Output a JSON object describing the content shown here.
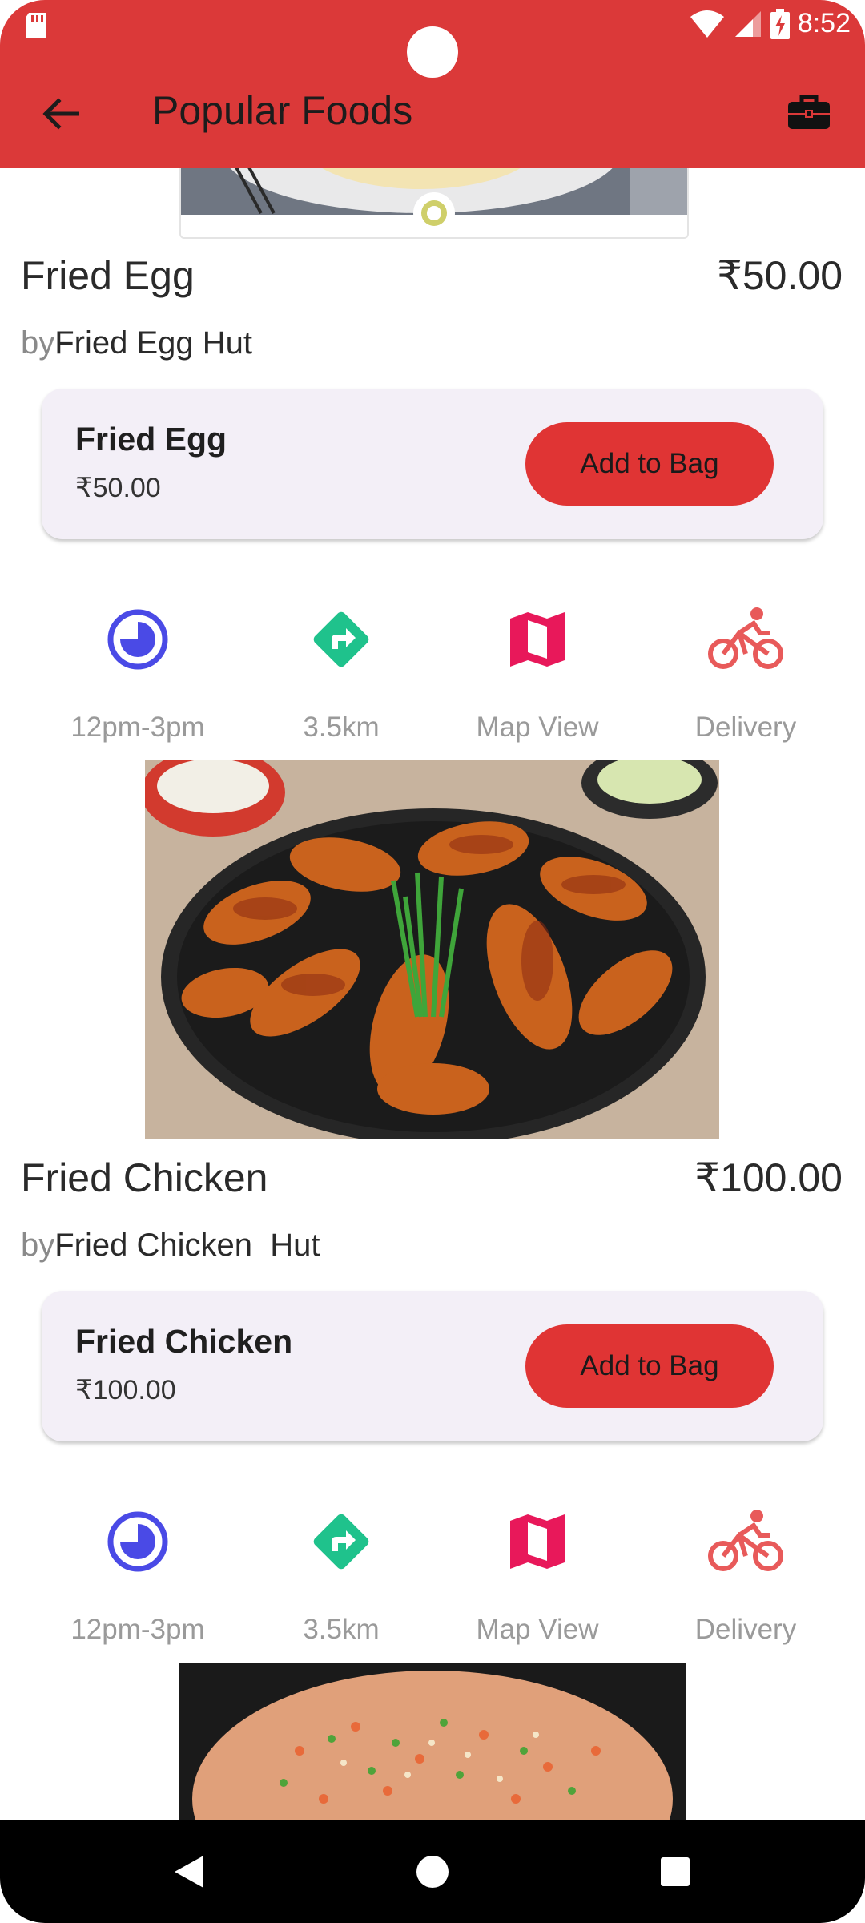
{
  "status_bar": {
    "time": "8:52"
  },
  "appbar": {
    "title": "Popular Foods",
    "back_icon": "arrow-back-icon",
    "bag_icon": "briefcase-icon"
  },
  "colors": {
    "primary": "#db3939",
    "button": "#e03434",
    "card_bg": "#f3eff7",
    "time_icon": "#4a4ae6",
    "distance_icon": "#1fc28c",
    "map_icon": "#e8185a",
    "delivery_icon": "#e85a5a"
  },
  "foods": [
    {
      "name": "Fried Egg",
      "price": "₹50.00",
      "by_prefix": "by",
      "vendor": "Fried Egg Hut",
      "card_name": "Fried Egg",
      "card_price": "₹50.00",
      "button_label": "Add to Bag",
      "info": [
        {
          "icon": "clock-icon",
          "label": "12pm-3pm"
        },
        {
          "icon": "directions-icon",
          "label": "3.5km"
        },
        {
          "icon": "map-icon",
          "label": "Map View"
        },
        {
          "icon": "bicycle-icon",
          "label": "Delivery"
        }
      ]
    },
    {
      "name": "Fried Chicken",
      "price": "₹100.00",
      "by_prefix": "by",
      "vendor": "Fried Chicken  Hut",
      "card_name": "Fried Chicken",
      "card_price": "₹100.00",
      "button_label": "Add to Bag",
      "info": [
        {
          "icon": "clock-icon",
          "label": "12pm-3pm"
        },
        {
          "icon": "directions-icon",
          "label": "3.5km"
        },
        {
          "icon": "map-icon",
          "label": "Map View"
        },
        {
          "icon": "bicycle-icon",
          "label": "Delivery"
        }
      ]
    }
  ],
  "navbar": {
    "back_icon": "nav-back-icon",
    "home_icon": "nav-home-icon",
    "recents_icon": "nav-recents-icon"
  }
}
